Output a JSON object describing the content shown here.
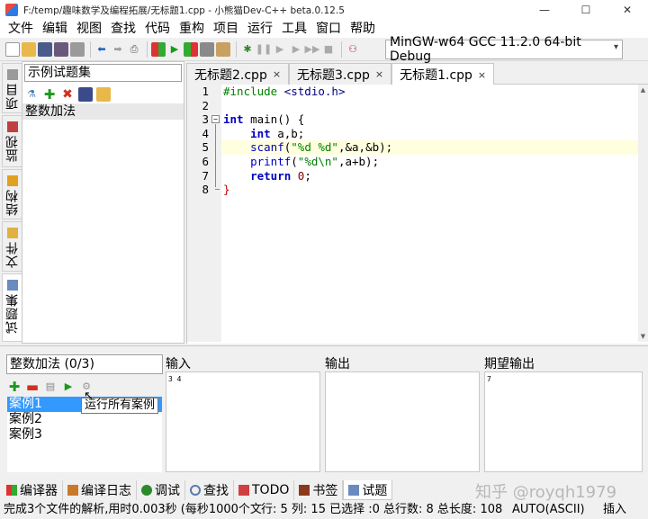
{
  "titlebar": {
    "title": "F:/temp/趣味数学及编程拓展/无标题1.cpp - 小熊猫Dev-C++ beta.0.12.5",
    "minimize": "—",
    "maximize": "☐",
    "close": "✕"
  },
  "menubar": {
    "items": [
      "文件",
      "编辑",
      "视图",
      "查找",
      "代码",
      "重构",
      "项目",
      "运行",
      "工具",
      "窗口",
      "帮助"
    ]
  },
  "toolbar": {
    "compiler": "MinGW-w64 GCC 11.2.0 64-bit Debug"
  },
  "left_tabs": [
    "项目",
    "监视",
    "结构",
    "文件",
    "试题集"
  ],
  "problemset": {
    "name": "示例试题集",
    "problems": [
      "整数加法"
    ]
  },
  "editor": {
    "tabs": [
      {
        "label": "无标题2.cpp",
        "close": "×"
      },
      {
        "label": "无标题3.cpp",
        "close": "×"
      },
      {
        "label": "无标题1.cpp",
        "close": "×"
      }
    ],
    "line_numbers": [
      "1",
      "2",
      "3",
      "4",
      "5",
      "6",
      "7",
      "8"
    ],
    "code": {
      "l1_pp": "#include ",
      "l1_hdr": "<stdio.h>",
      "l3_kw": "int",
      "l3_rest": " main() {",
      "l4_kw": "int",
      "l4_rest": " a,b;",
      "l5_fn": "scanf",
      "l5_p1": "(",
      "l5_str": "\"%d %d\"",
      "l5_rest": ",&a,&b);",
      "l6_fn": "printf",
      "l6_p1": "(",
      "l6_str": "\"%d\\n\"",
      "l6_rest": ",a+b);",
      "l7_kw": "return",
      "l7_num": "0",
      "l7_rest": ";",
      "l8": "}"
    }
  },
  "testcases": {
    "problem_title": "整数加法 (0/3)",
    "cases": [
      "案例1",
      "案例2",
      "案例3"
    ],
    "tooltip": "运行所有案例",
    "input_label": "输入",
    "output_label": "输出",
    "expected_label": "期望输出",
    "input_value": "3 4",
    "output_value": "",
    "expected_value": "7"
  },
  "bottom_tabs": [
    "编译器",
    "编译日志",
    "调试",
    "查找",
    "TODO",
    "书签",
    "试题"
  ],
  "watermark": "知乎 @royqh1979",
  "statusbar": {
    "message": "完成3个文件的解析,用时0.003秒 (每秒1000个文",
    "position": "行: 5 列: 15 已选择 :0 总行数: 8 总长度: 108",
    "encoding": "AUTO(ASCII)",
    "mode": "插入"
  },
  "colors": {
    "selection": "#3399ff",
    "current_line": "#ffffe0",
    "keyword": "#0000c0",
    "string": "#008000"
  }
}
